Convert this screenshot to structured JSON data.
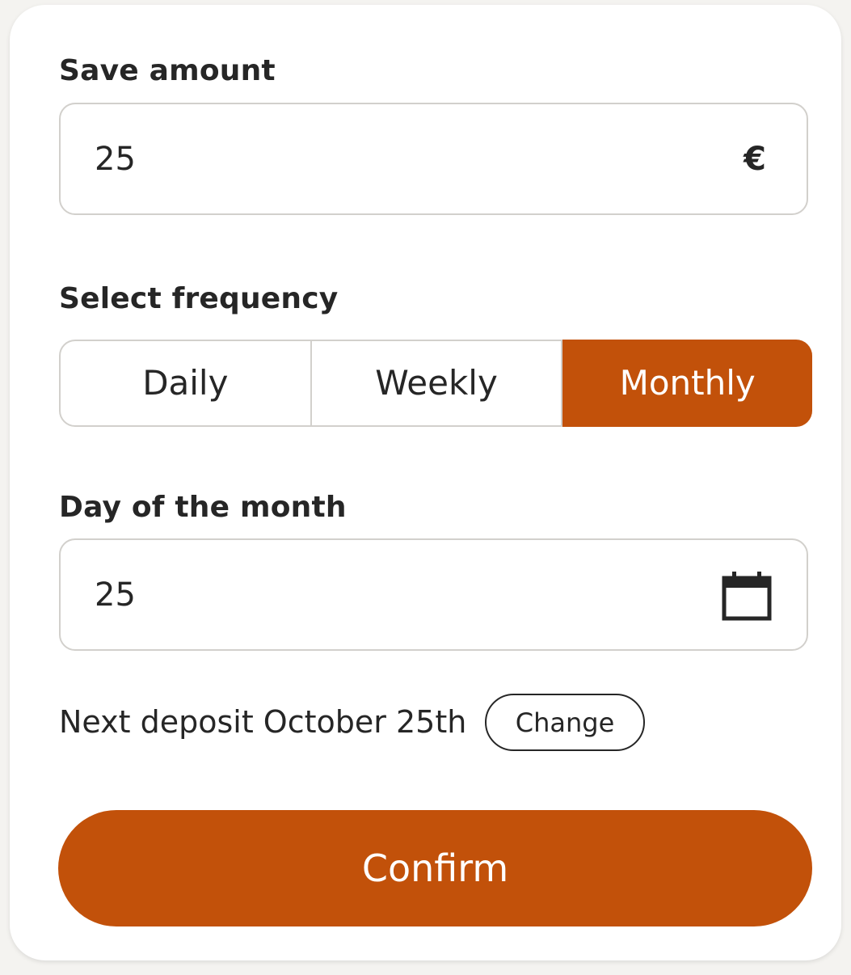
{
  "colors": {
    "accent": "#c2510a",
    "background": "#f4f3f0",
    "card": "#ffffff",
    "border": "#d2d0cc",
    "text": "#262626"
  },
  "save_amount": {
    "label": "Save amount",
    "value": "25",
    "currency_symbol": "€"
  },
  "frequency": {
    "label": "Select frequency",
    "options": [
      "Daily",
      "Weekly",
      "Monthly"
    ],
    "selected": "Monthly"
  },
  "day_of_month": {
    "label": "Day of the month",
    "value": "25",
    "icon": "calendar-icon"
  },
  "next_deposit": {
    "text": "Next deposit October 25th",
    "change_label": "Change"
  },
  "confirm_label": "Confirm"
}
